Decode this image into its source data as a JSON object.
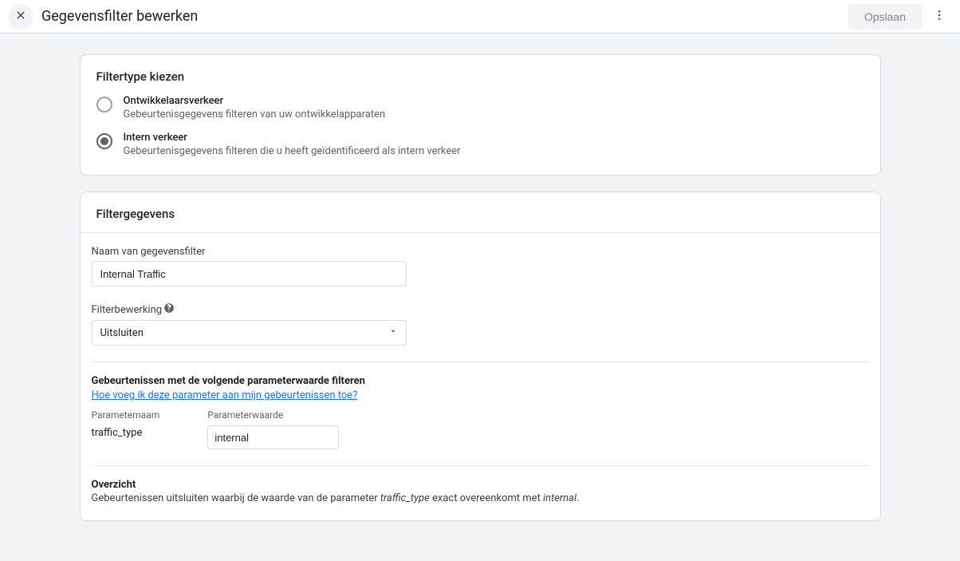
{
  "header": {
    "title": "Gegevensfilter bewerken",
    "save_label": "Opslaan"
  },
  "filter_type": {
    "title": "Filtertype kiezen",
    "options": [
      {
        "label": "Ontwikkelaarsverkeer",
        "desc": "Gebeurtenisgegevens filteren van uw ontwikkelapparaten",
        "selected": false
      },
      {
        "label": "Intern verkeer",
        "desc": "Gebeurtenisgegevens filteren die u heeft geïdentificeerd als intern verkeer",
        "selected": true
      }
    ]
  },
  "details": {
    "title": "Filtergegevens",
    "name_label": "Naam van gegevensfilter",
    "name_value": "Internal Traffic",
    "operation_label": "Filterbewerking",
    "operation_value": "Uitsluiten",
    "event_filter_title": "Gebeurtenissen met de volgende parameterwaarde filteren",
    "help_link": "Hoe voeg ik deze parameter aan mijn gebeurtenissen toe?",
    "param_name_header": "Parameternaam",
    "param_value_header": "Parameterwaarde",
    "param_name": "traffic_type",
    "param_value": "internal",
    "overview_title": "Overzicht",
    "overview_prefix": "Gebeurtenissen uitsluiten waarbij de waarde van de parameter ",
    "overview_param": "traffic_type",
    "overview_middle": " exact overeenkomt met ",
    "overview_value": "internal",
    "overview_suffix": "."
  }
}
